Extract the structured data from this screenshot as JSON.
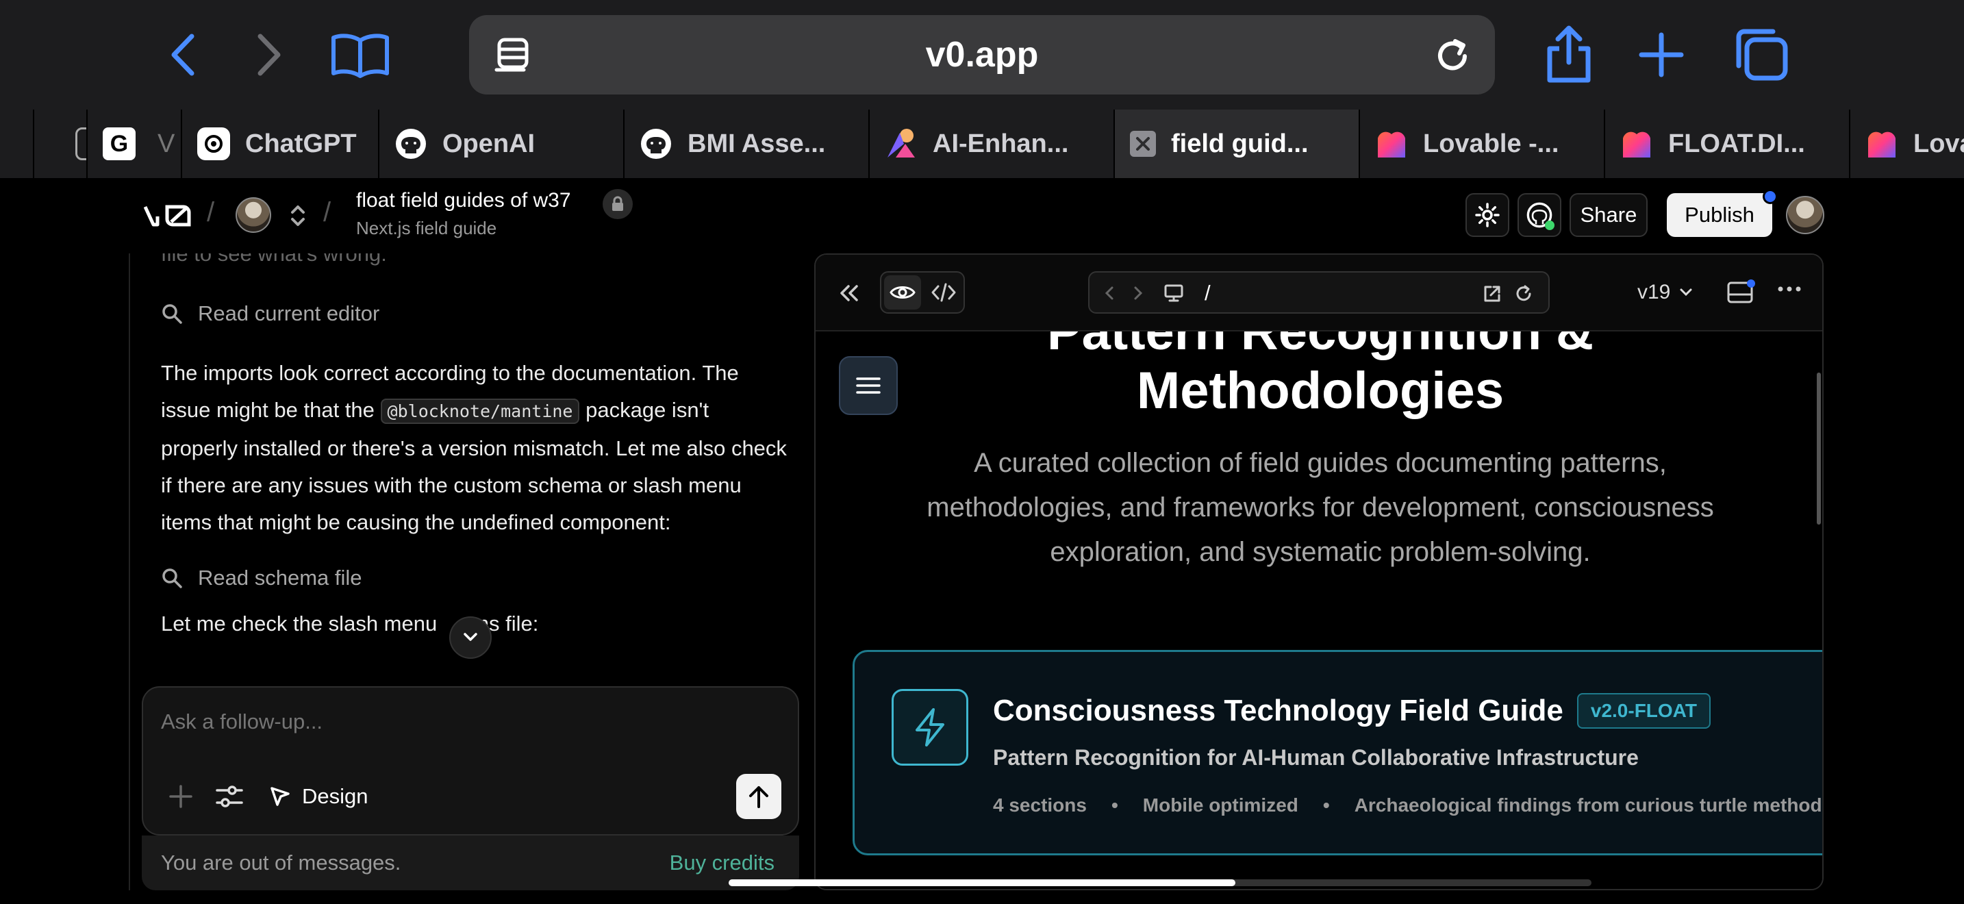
{
  "browser": {
    "url": "v0.app",
    "tabs": [
      {
        "label": "",
        "icon": "partial-tab-icon"
      },
      {
        "label": "",
        "icon": "g-letter-icon"
      },
      {
        "label": "ChatGPT",
        "icon": "openai-icon"
      },
      {
        "label": "OpenAI",
        "icon": "github-icon"
      },
      {
        "label": "BMI Asse...",
        "icon": "github-icon"
      },
      {
        "label": "AI-Enhan...",
        "icon": "figma-icon"
      },
      {
        "label": "field guid...",
        "icon": "close-icon",
        "active": true
      },
      {
        "label": "Lovable -...",
        "icon": "lovable-heart-icon"
      },
      {
        "label": "FLOAT.DI...",
        "icon": "lovable-heart-icon"
      },
      {
        "label": "Lova",
        "icon": "lovable-heart-icon"
      }
    ]
  },
  "header": {
    "project_title": "float field guides of w37",
    "project_subtitle": "Next.js field guide",
    "share_label": "Share",
    "publish_label": "Publish",
    "accent": "#2f6bff"
  },
  "chat": {
    "partial_line": "file to see what's wrong:",
    "tool_read_editor": "Read current editor",
    "message_1_part_a": "The imports look correct according to the documentation. The issue might be that the",
    "message_1_code": "@blocknote/mantine",
    "message_1_part_b": "package isn't properly installed or there's a version mismatch. Let me also check if there are any issues with the custom schema or slash menu items that might be causing the undefined component:",
    "tool_read_schema": "Read schema file",
    "message_2_a": "Let me check the slash menu",
    "message_2_b": "ms file:"
  },
  "composer": {
    "placeholder": "Ask a follow-up...",
    "design_label": "Design",
    "out_of_messages": "You are out of messages.",
    "buy_credits": "Buy credits",
    "buy_credits_color": "#4fb39a"
  },
  "preview": {
    "path": "/",
    "version": "v19",
    "heading_line1": "Pattern Recognition &",
    "heading_line2": "Methodologies",
    "description": "A curated collection of field guides documenting patterns, methodologies, and frameworks for development, consciousness exploration, and systematic problem-solving.",
    "card": {
      "title": "Consciousness Technology Field Guide",
      "badge": "v2.0-FLOAT",
      "subtitle": "Pattern Recognition for AI-Human Collaborative Infrastructure",
      "meta": [
        "4 sections",
        "Mobile optimized",
        "Archaeological findings from curious turtle methodo"
      ],
      "accent": "#3fb7cf"
    }
  }
}
